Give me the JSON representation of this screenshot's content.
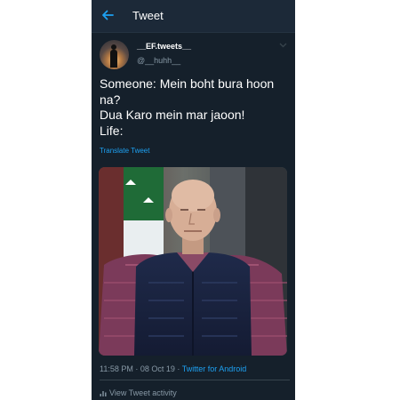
{
  "header": {
    "title": "Tweet",
    "back_icon": "back-arrow-icon"
  },
  "tweet": {
    "display_name": "__EF.tweets__",
    "handle": "@__huhh__",
    "menu_icon": "chevron-down-icon",
    "text_lines": [
      "Someone: Mein boht bura hoon",
      "na?",
      "Dua Karo mein mar jaoon!",
      "Life:"
    ],
    "translate_label": "Translate Tweet",
    "media_description_icon": "photo-man-in-vest",
    "time": "11:58 PM",
    "date": "08 Oct 19",
    "separator": " · ",
    "source": "Twitter for Android",
    "activity_label": "View Tweet activity",
    "activity_icon": "bar-chart-icon"
  },
  "colors": {
    "background": "#15202b",
    "accent": "#1da1f2",
    "muted": "#8899a6"
  }
}
